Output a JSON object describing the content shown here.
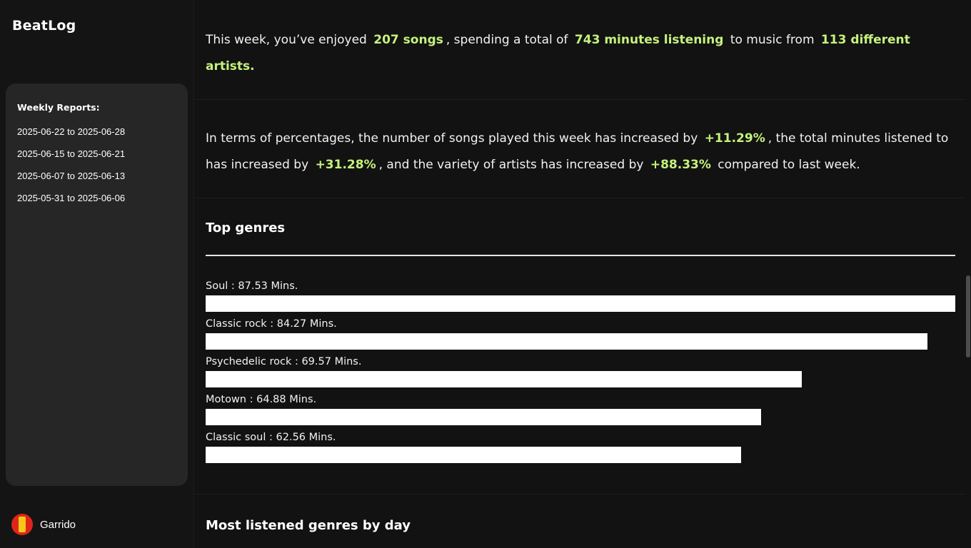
{
  "app": {
    "title": "BeatLog"
  },
  "sidebar": {
    "reports_title": "Weekly Reports:",
    "reports": [
      "2025-06-22 to 2025-06-28",
      "2025-06-15 to 2025-06-21",
      "2025-06-07 to 2025-06-13",
      "2025-05-31 to 2025-06-06"
    ],
    "user": {
      "name": "Garrido"
    }
  },
  "summary": {
    "p1": {
      "t1": "This week, you’ve enjoyed",
      "songs": "207 songs",
      "t2": ", spending a total of",
      "minutes": "743 minutes listening",
      "t3": "to music from",
      "artists": "113 different artists."
    },
    "p2": {
      "t1": "In terms of percentages, the number of songs played this week has increased by",
      "songs_pct": "+11.29%",
      "t2": ", the total minutes listened to has increased by",
      "minutes_pct": "+31.28%",
      "t3": ", and the variety of artists has increased by",
      "artists_pct": "+88.33%",
      "t4": "compared to last week."
    }
  },
  "top_genres": {
    "title": "Top genres",
    "max_minutes": 87.53,
    "items": [
      {
        "label": "Soul : 87.53 Mins.",
        "minutes": 87.53
      },
      {
        "label": "Classic rock : 84.27 Mins.",
        "minutes": 84.27
      },
      {
        "label": "Psychedelic rock : 69.57 Mins.",
        "minutes": 69.57
      },
      {
        "label": "Motown : 64.88 Mins.",
        "minutes": 64.88
      },
      {
        "label": "Classic soul : 62.56 Mins.",
        "minutes": 62.56
      }
    ]
  },
  "by_day": {
    "title": "Most listened genres by day"
  },
  "colors": {
    "accent": "#c5f27d",
    "bar": "#ffffff",
    "avatar_red": "#e0251b",
    "avatar_yellow": "#f5c818"
  },
  "icons": {
    "avatar": "user-avatar-icon"
  }
}
